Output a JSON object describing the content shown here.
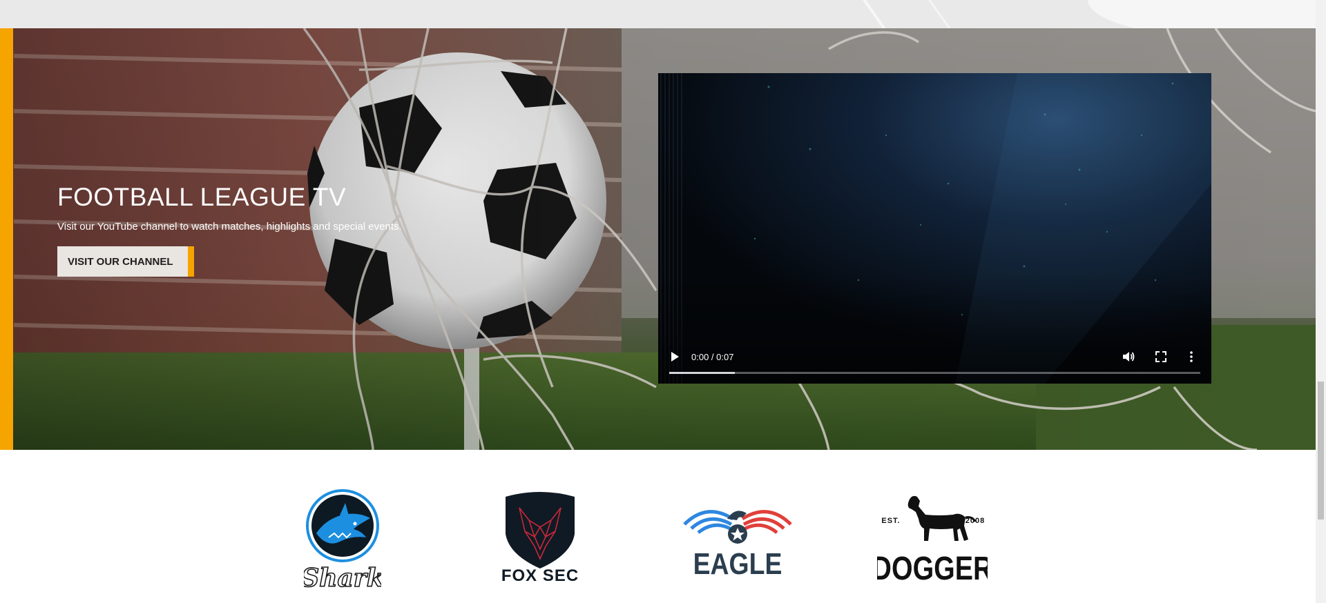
{
  "hero": {
    "title": "FOOTBALL LEAGUE TV",
    "subtitle": "Visit our YouTube channel to watch matches, highlights and special events.",
    "button_label": "VISIT OUR CHANNEL",
    "accent_color": "#f5a400"
  },
  "video": {
    "time": "0:00 / 0:07",
    "buffered_fraction": 0.124,
    "icons": [
      "play-icon",
      "volume-icon",
      "fullscreen-icon",
      "more-options-icon"
    ]
  },
  "logos": [
    {
      "name": "shark-logo",
      "text": "Shark"
    },
    {
      "name": "fox-sec-logo",
      "text": "FOX SEC"
    },
    {
      "name": "eagle-logo",
      "text": "EAGLE"
    },
    {
      "name": "dogger-logo",
      "text": "DOGGER",
      "est": "EST.",
      "year": "2008"
    }
  ]
}
